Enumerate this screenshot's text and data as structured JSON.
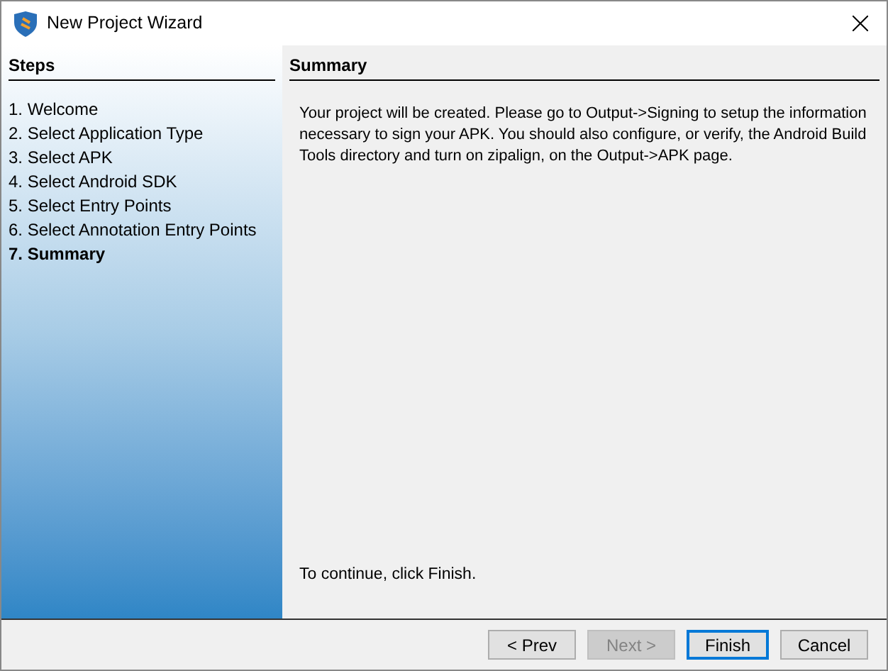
{
  "window": {
    "title": "New Project Wizard"
  },
  "steps": {
    "heading": "Steps",
    "items": [
      {
        "label": "1. Welcome",
        "selected": false
      },
      {
        "label": "2. Select Application Type",
        "selected": false
      },
      {
        "label": "3. Select APK",
        "selected": false
      },
      {
        "label": "4. Select Android SDK",
        "selected": false
      },
      {
        "label": "5. Select Entry Points",
        "selected": false
      },
      {
        "label": "6. Select Annotation Entry Points",
        "selected": false
      },
      {
        "label": "7. Summary",
        "selected": true
      }
    ]
  },
  "content": {
    "heading": "Summary",
    "message": "Your project will be created. Please go to Output->Signing to setup the information necessary to sign your APK. You should also configure, or verify, the Android Build Tools directory and turn on zipalign, on the Output->APK page.",
    "footer": "To continue, click Finish."
  },
  "buttons": [
    {
      "label": "< Prev",
      "disabled": false,
      "default": false
    },
    {
      "label": "Next >",
      "disabled": true,
      "default": false
    },
    {
      "label": "Finish",
      "disabled": false,
      "default": true
    },
    {
      "label": "Cancel",
      "disabled": false,
      "default": false
    }
  ]
}
